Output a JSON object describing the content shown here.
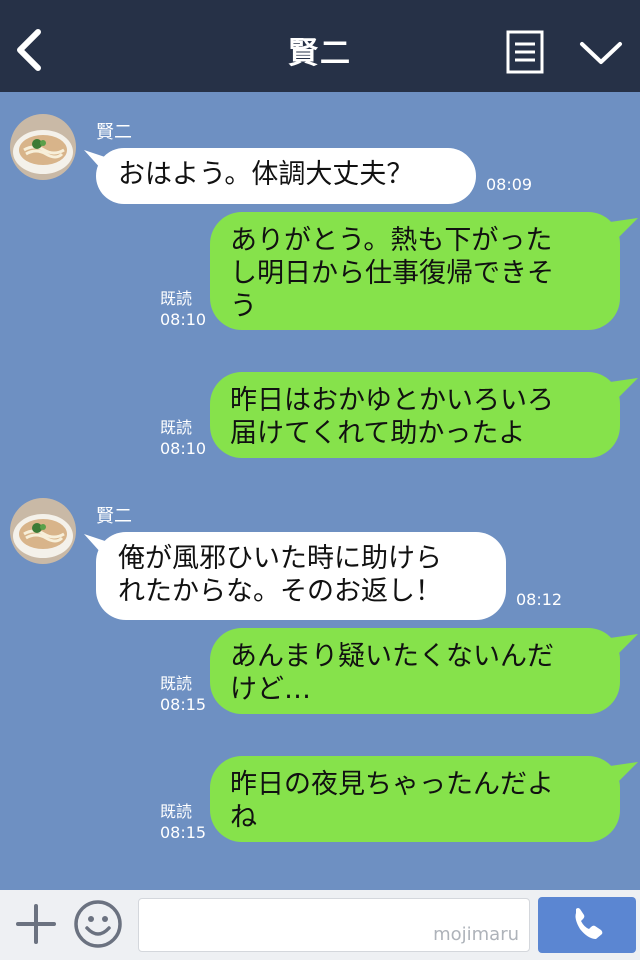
{
  "header": {
    "title": "賢二",
    "icons": {
      "back": "chevron-left-icon",
      "menu": "notes-menu-icon",
      "more": "chevron-down-icon"
    }
  },
  "messages": [
    {
      "direction": "incoming",
      "sender": "賢二",
      "lines": [
        "おはよう。体調大丈夫？"
      ],
      "time": "08:09"
    },
    {
      "direction": "outgoing",
      "lines": [
        "ありがとう。熱も下がった",
        "し明日から仕事復帰できそ",
        "う"
      ],
      "read": "既読",
      "time": "08:10"
    },
    {
      "direction": "outgoing",
      "lines": [
        "昨日はおかゆとかいろいろ",
        "届けてくれて助かったよ"
      ],
      "read": "既読",
      "time": "08:10"
    },
    {
      "direction": "incoming",
      "sender": "賢二",
      "lines": [
        "俺が風邪ひいた時に助けら",
        "れたからな。そのお返し！"
      ],
      "time": "08:12"
    },
    {
      "direction": "outgoing",
      "lines": [
        "あんまり疑いたくないんだ",
        "けど…"
      ],
      "read": "既読",
      "time": "08:15"
    },
    {
      "direction": "outgoing",
      "lines": [
        "昨日の夜見ちゃったんだよ",
        "ね"
      ],
      "read": "既読",
      "time": "08:15"
    }
  ],
  "footer": {
    "input_value": "",
    "watermark": "mojimaru",
    "icons": {
      "add": "plus-icon",
      "sticker": "smiley-icon",
      "call": "phone-icon"
    }
  },
  "colors": {
    "header_bg": "#263147",
    "chat_bg": "#6e90c2",
    "incoming_bubble": "#ffffff",
    "outgoing_bubble": "#86e24b",
    "call_button": "#5b86d2"
  }
}
